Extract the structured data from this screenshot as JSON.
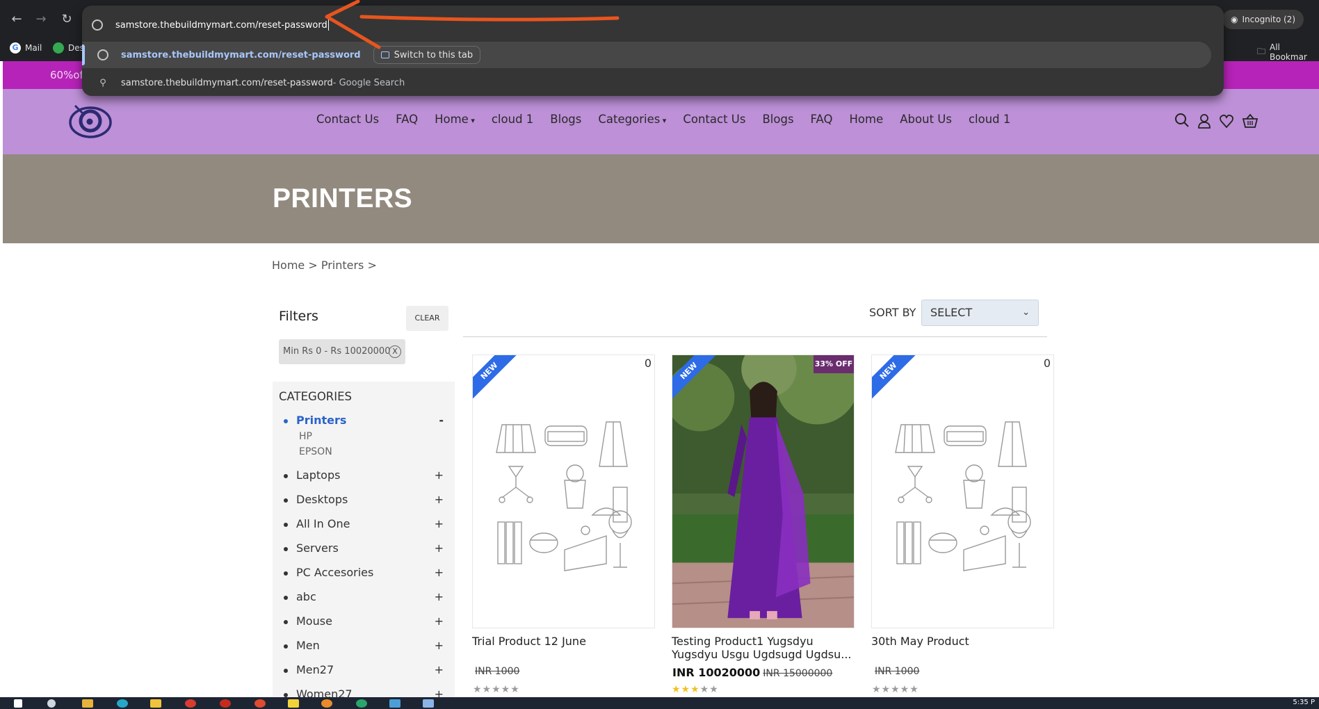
{
  "browser": {
    "url": "samstore.thebuildmymart.com/reset-password",
    "incognito_label": "Incognito (2)",
    "bookmarks": [
      "Mail",
      "Des"
    ],
    "all_bookmarks": "All Bookmar",
    "suggestions": [
      {
        "url": "samstore.thebuildmymart.com/reset-password",
        "action": "Switch to this tab"
      },
      {
        "url": "samstore.thebuildmymart.com/reset-password",
        "suffix": " - Google Search"
      }
    ]
  },
  "promo": {
    "text": "60%of"
  },
  "menu": [
    "Contact Us",
    "FAQ",
    "Home",
    "cloud 1",
    "Blogs",
    "Categories",
    "Contact Us",
    "Blogs",
    "FAQ",
    "Home",
    "About Us",
    "cloud 1"
  ],
  "hero": {
    "title": "PRINTERS"
  },
  "breadcrumb": "Home > Printers >",
  "filters": {
    "title": "Filters",
    "clear": "CLEAR",
    "range": "Min Rs 0 - Rs 10020000",
    "range_close": "X",
    "categories_title": "CATEGORIES",
    "categories": [
      {
        "name": "Printers",
        "toggle": "-",
        "subs": [
          "HP",
          "EPSON"
        ]
      },
      {
        "name": "Laptops",
        "toggle": "+"
      },
      {
        "name": "Desktops",
        "toggle": "+"
      },
      {
        "name": "All In One",
        "toggle": "+"
      },
      {
        "name": "Servers",
        "toggle": "+"
      },
      {
        "name": "PC Accesories",
        "toggle": "+"
      },
      {
        "name": "abc",
        "toggle": "+"
      },
      {
        "name": "Mouse",
        "toggle": "+"
      },
      {
        "name": "Men",
        "toggle": "+"
      },
      {
        "name": "Men27",
        "toggle": "+"
      },
      {
        "name": "Women27",
        "toggle": "+"
      }
    ]
  },
  "sort": {
    "label": "SORT BY",
    "value": "SELECT"
  },
  "products": [
    {
      "ribbon": "NEW",
      "count": "0",
      "title": "Trial Product 12 June",
      "price": "",
      "old_price": "INR 1000",
      "rating": 0
    },
    {
      "ribbon": "NEW",
      "badge": "33% OFF",
      "title": "Testing Product1 Yugsdyu Yugsdyu Usgu Ugdsugd Ugdsu...",
      "price": "INR 10020000",
      "old_price": "INR 15000000",
      "rating": 3
    },
    {
      "ribbon": "NEW",
      "count": "0",
      "title": "30th May Product",
      "price": "",
      "old_price": "INR 1000",
      "rating": 0
    }
  ],
  "taskbar": {
    "time": "5:35 P"
  },
  "colors": {
    "promo": "#b623b8",
    "header": "#bd90d7",
    "hero": "#928a7f",
    "accent": "#2a63c9",
    "ribbon": "#2e6be6"
  }
}
